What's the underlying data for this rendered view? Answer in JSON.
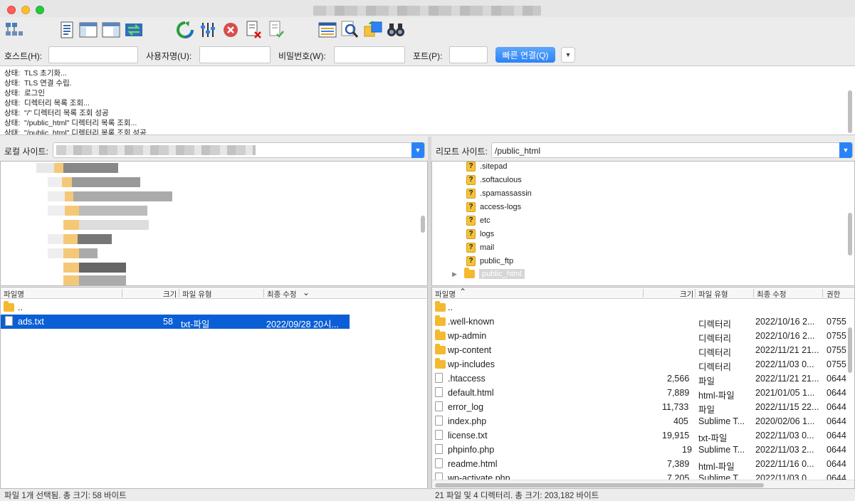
{
  "quickconnect": {
    "host_label": "호스트(H):",
    "user_label": "사용자명(U):",
    "pass_label": "비밀번호(W):",
    "port_label": "포트(P):",
    "connect_label": "빠른 연결(Q)"
  },
  "log": {
    "lines": [
      {
        "key": "상태:",
        "text": "TLS 초기화..."
      },
      {
        "key": "상태:",
        "text": "TLS 연결 수립."
      },
      {
        "key": "상태:",
        "text": "로그인"
      },
      {
        "key": "상태:",
        "text": "디렉터리 목록 조회..."
      },
      {
        "key": "상태:",
        "text": "\"/\" 디렉터리 목록 조회 성공"
      },
      {
        "key": "상태:",
        "text": "\"/public_html\" 디렉터리 목록 조회..."
      },
      {
        "key": "상태:",
        "text": "\"/public_html\" 디렉터리 목록 조회 성공"
      }
    ]
  },
  "local": {
    "site_label": "로컬 사이트:",
    "headers": {
      "name": "파일명",
      "size": "크기",
      "type": "파일 유형",
      "modified": "최종 수정"
    },
    "files": [
      {
        "name": "..",
        "size": "",
        "type": "",
        "modified": "",
        "kind": "folder"
      },
      {
        "name": "ads.txt",
        "size": "58",
        "type": "txt-파일",
        "modified": "2022/09/28 20시...",
        "kind": "file",
        "selected": true
      }
    ],
    "status": "파일 1개 선택됨. 총 크기: 58 바이트"
  },
  "remote": {
    "site_label": "리모트 사이트:",
    "path": "/public_html",
    "tree": [
      ".sitepad",
      ".softaculous",
      ".spamassassin",
      "access-logs",
      "etc",
      "logs",
      "mail",
      "public_ftp",
      "public_html"
    ],
    "headers": {
      "name": "파일명",
      "size": "크기",
      "type": "파일 유형",
      "modified": "최종 수정",
      "perm": "권한"
    },
    "files": [
      {
        "name": "..",
        "size": "",
        "type": "",
        "modified": "",
        "perm": "",
        "kind": "folder"
      },
      {
        "name": ".well-known",
        "size": "",
        "type": "디렉터리",
        "modified": "2022/10/16 2...",
        "perm": "0755",
        "kind": "folder"
      },
      {
        "name": "wp-admin",
        "size": "",
        "type": "디렉터리",
        "modified": "2022/10/16 2...",
        "perm": "0755",
        "kind": "folder"
      },
      {
        "name": "wp-content",
        "size": "",
        "type": "디렉터리",
        "modified": "2022/11/21 21...",
        "perm": "0755",
        "kind": "folder"
      },
      {
        "name": "wp-includes",
        "size": "",
        "type": "디렉터리",
        "modified": "2022/11/03 0...",
        "perm": "0755",
        "kind": "folder"
      },
      {
        "name": ".htaccess",
        "size": "2,566",
        "type": "파일",
        "modified": "2022/11/21 21...",
        "perm": "0644",
        "kind": "file"
      },
      {
        "name": "default.html",
        "size": "7,889",
        "type": "html-파일",
        "modified": "2021/01/05 1...",
        "perm": "0644",
        "kind": "file"
      },
      {
        "name": "error_log",
        "size": "11,733",
        "type": "파일",
        "modified": "2022/11/15 22...",
        "perm": "0644",
        "kind": "file"
      },
      {
        "name": "index.php",
        "size": "405",
        "type": "Sublime T...",
        "modified": "2020/02/06 1...",
        "perm": "0644",
        "kind": "file"
      },
      {
        "name": "license.txt",
        "size": "19,915",
        "type": "txt-파일",
        "modified": "2022/11/03 0...",
        "perm": "0644",
        "kind": "file"
      },
      {
        "name": "phpinfo.php",
        "size": "19",
        "type": "Sublime T...",
        "modified": "2022/11/03 2...",
        "perm": "0644",
        "kind": "file"
      },
      {
        "name": "readme.html",
        "size": "7,389",
        "type": "html-파일",
        "modified": "2022/11/16 0...",
        "perm": "0644",
        "kind": "file"
      },
      {
        "name": "wp-activate.php",
        "size": "7,205",
        "type": "Sublime T...",
        "modified": "2022/11/03 0...",
        "perm": "0644",
        "kind": "file"
      }
    ],
    "status": "21 파일 및 4 디렉터리. 총 크기: 203,182 바이트"
  }
}
